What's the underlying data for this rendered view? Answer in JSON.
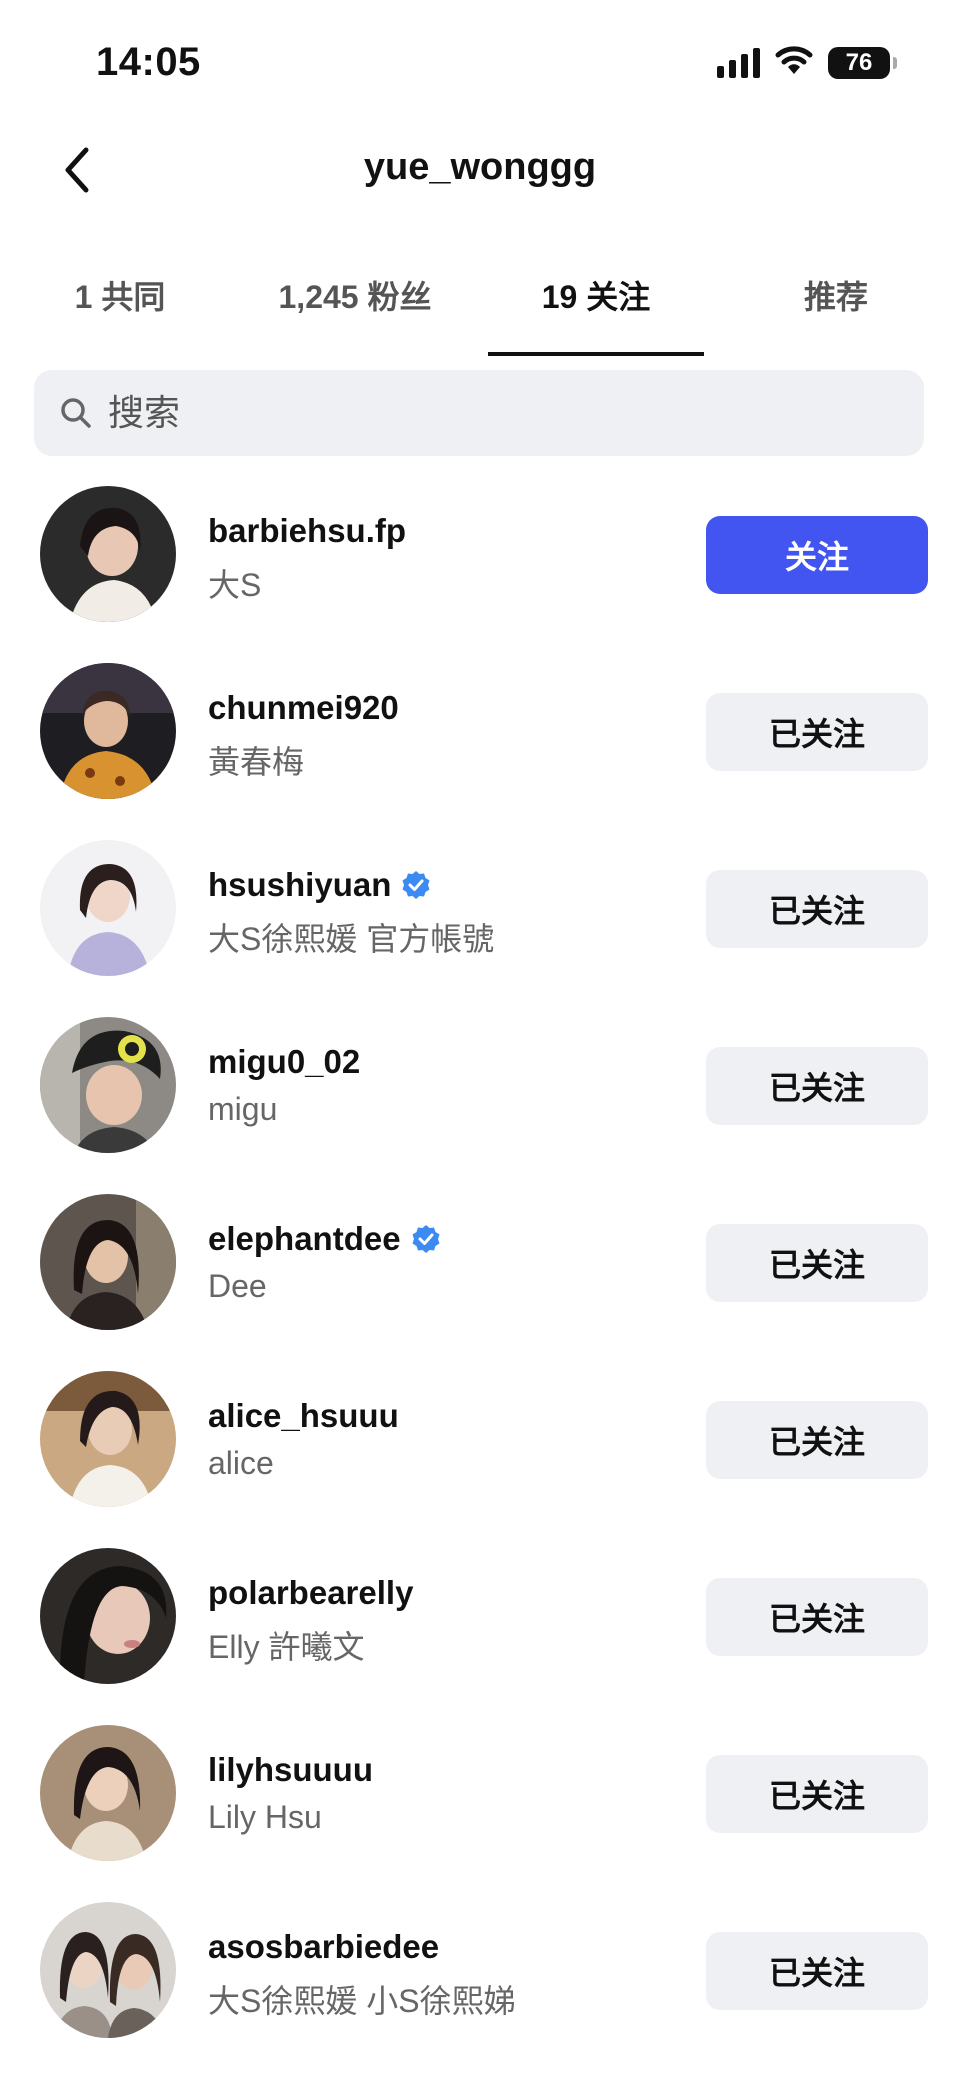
{
  "status_bar": {
    "time": "14:05",
    "battery": "76",
    "icons": [
      "signal-icon",
      "wifi-icon",
      "battery-icon"
    ]
  },
  "header": {
    "title": "yue_wonggg",
    "back_icon": "chevron-left-icon"
  },
  "tabs": [
    {
      "label": "1 共同",
      "active": false
    },
    {
      "label": "1,245 粉丝",
      "active": false
    },
    {
      "label": "19 关注",
      "active": true
    },
    {
      "label": "推荐",
      "active": false
    }
  ],
  "search": {
    "placeholder": "搜索",
    "icon": "search-icon"
  },
  "accounts": [
    {
      "username": "barbiehsu.fp",
      "name": "大S",
      "verified": false,
      "button": "关注",
      "following": false
    },
    {
      "username": "chunmei920",
      "name": "黃春梅",
      "verified": false,
      "button": "已关注",
      "following": true
    },
    {
      "username": "hsushiyuan",
      "name": "大S徐熙媛  官方帳號",
      "verified": true,
      "button": "已关注",
      "following": true
    },
    {
      "username": "migu0_02",
      "name": "migu",
      "verified": false,
      "button": "已关注",
      "following": true
    },
    {
      "username": "elephantdee",
      "name": "Dee",
      "verified": true,
      "button": "已关注",
      "following": true
    },
    {
      "username": "alice_hsuuu",
      "name": "alice",
      "verified": false,
      "button": "已关注",
      "following": true
    },
    {
      "username": "polarbearelly",
      "name": "Elly 許曦文",
      "verified": false,
      "button": "已关注",
      "following": true
    },
    {
      "username": "lilyhsuuuu",
      "name": "Lily Hsu",
      "verified": false,
      "button": "已关注",
      "following": true
    },
    {
      "username": "asosbarbiedee",
      "name": "大S徐熙媛 小S徐熙娣",
      "verified": false,
      "button": "已关注",
      "following": true
    }
  ],
  "colors": {
    "follow_button": "#4355f0",
    "following_button": "#eef0f3",
    "verified_badge": "#3d8bf2"
  }
}
